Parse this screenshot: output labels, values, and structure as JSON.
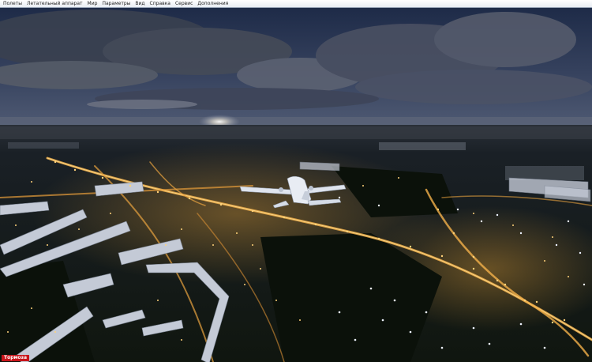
{
  "menu": {
    "items": [
      {
        "id": "flights",
        "label": "Полеты"
      },
      {
        "id": "aircraft",
        "label": "Летательный аппарат"
      },
      {
        "id": "world",
        "label": "Мир"
      },
      {
        "id": "options",
        "label": "Параметры"
      },
      {
        "id": "view",
        "label": "Вид"
      },
      {
        "id": "help",
        "label": "Справка"
      },
      {
        "id": "service",
        "label": "Сервис"
      },
      {
        "id": "addons",
        "label": "Дополнения"
      }
    ]
  },
  "status": {
    "pause_label": "Тормоза"
  },
  "colors": {
    "sky_top": "#1d2c4a",
    "sky_horizon": "#4c5670",
    "ground": "#131a12",
    "city_light": "#ffc24a",
    "building": "#c9ced8",
    "badge": "#c8141a"
  }
}
